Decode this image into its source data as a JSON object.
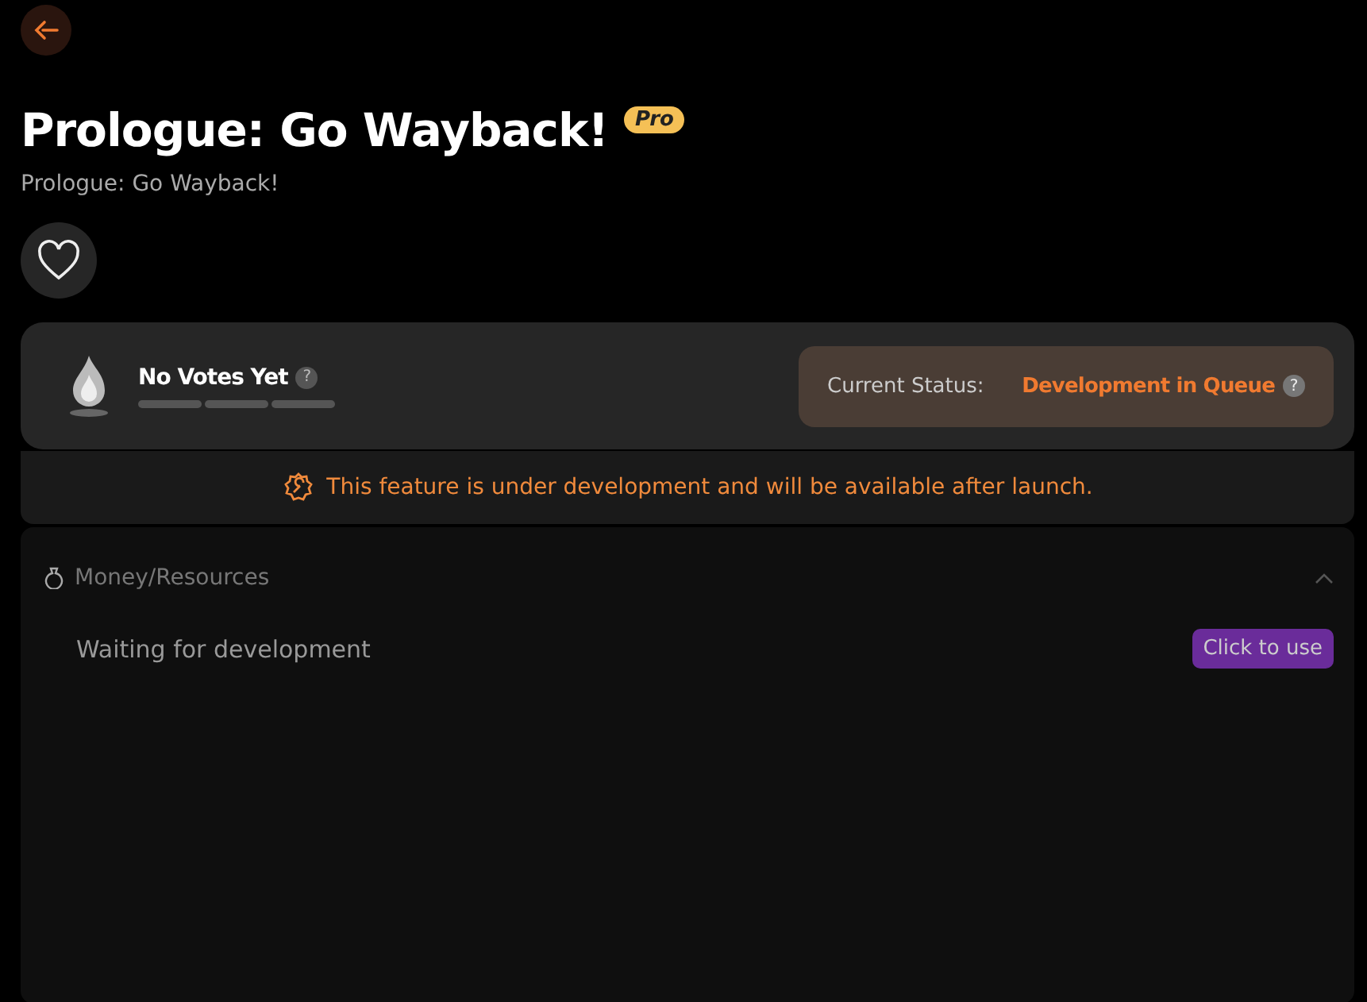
{
  "header": {
    "title": "Prologue: Go Wayback!",
    "badge": "Pro",
    "subtitle": "Prologue: Go Wayback!",
    "favorited": false
  },
  "votes": {
    "label": "No Votes Yet",
    "help": "?"
  },
  "status": {
    "label": "Current Status:",
    "value": "Development in Queue",
    "help": "?"
  },
  "notice": "This feature is under development and will be available after launch.",
  "sections": [
    {
      "title": "Money/Resources",
      "expanded": true,
      "items": [
        {
          "label": "Waiting for development",
          "action": "Click to use"
        }
      ]
    }
  ]
}
